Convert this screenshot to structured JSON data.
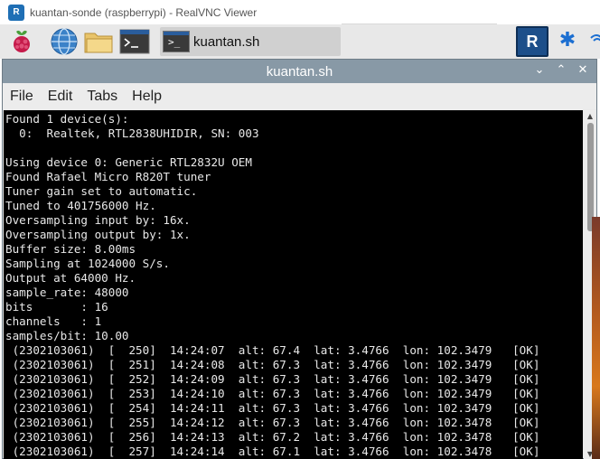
{
  "vnc": {
    "logo_text": "R",
    "title": "kuantan-sonde (raspberrypi) - RealVNC Viewer"
  },
  "taskbar": {
    "items": [
      {
        "icon": "raspberry-pi-menu-icon"
      },
      {
        "icon": "web-browser-globe-icon"
      },
      {
        "icon": "file-manager-folder-icon"
      },
      {
        "icon": "terminal-icon"
      }
    ],
    "active_task": {
      "icon": "terminal-icon",
      "prompt_glyph": ">_",
      "label": "kuantan.sh"
    },
    "tray": {
      "vnc_icon": "realvnc-tray-icon",
      "vnc_text": "R",
      "bluetooth_icon": "bluetooth-icon",
      "bluetooth_glyph": "✱",
      "wifi_icon": "wifi-icon"
    }
  },
  "window": {
    "title": "kuantan.sh",
    "controls": {
      "minimize": "⌄",
      "maximize": "⌃",
      "close": "✕"
    },
    "menu": [
      "File",
      "Edit",
      "Tabs",
      "Help"
    ]
  },
  "terminal": {
    "lines": [
      "Found 1 device(s):",
      "  0:  Realtek, RTL2838UHIDIR, SN: 003",
      "",
      "Using device 0: Generic RTL2832U OEM",
      "Found Rafael Micro R820T tuner",
      "Tuner gain set to automatic.",
      "Tuned to 401756000 Hz.",
      "Oversampling input by: 16x.",
      "Oversampling output by: 1x.",
      "Buffer size: 8.00ms",
      "Sampling at 1024000 S/s.",
      "Output at 64000 Hz.",
      "sample_rate: 48000",
      "bits       : 16",
      "channels   : 1",
      "samples/bit: 10.00",
      " (2302103061)  [  250]  14:24:07  alt: 67.4  lat: 3.4766  lon: 102.3479   [OK]",
      " (2302103061)  [  251]  14:24:08  alt: 67.3  lat: 3.4766  lon: 102.3479   [OK]",
      " (2302103061)  [  252]  14:24:09  alt: 67.3  lat: 3.4766  lon: 102.3479   [OK]",
      " (2302103061)  [  253]  14:24:10  alt: 67.3  lat: 3.4766  lon: 102.3479   [OK]",
      " (2302103061)  [  254]  14:24:11  alt: 67.3  lat: 3.4766  lon: 102.3479   [OK]",
      " (2302103061)  [  255]  14:24:12  alt: 67.3  lat: 3.4766  lon: 102.3478   [OK]",
      " (2302103061)  [  256]  14:24:13  alt: 67.2  lat: 3.4766  lon: 102.3478   [OK]",
      " (2302103061)  [  257]  14:24:14  alt: 67.1  lat: 3.4766  lon: 102.3478   [OK]"
    ]
  },
  "colors": {
    "terminal_bg": "#000000",
    "terminal_fg": "#e8e8e8",
    "titlebar": "#8899a6",
    "taskbar": "#e8e8e8"
  }
}
